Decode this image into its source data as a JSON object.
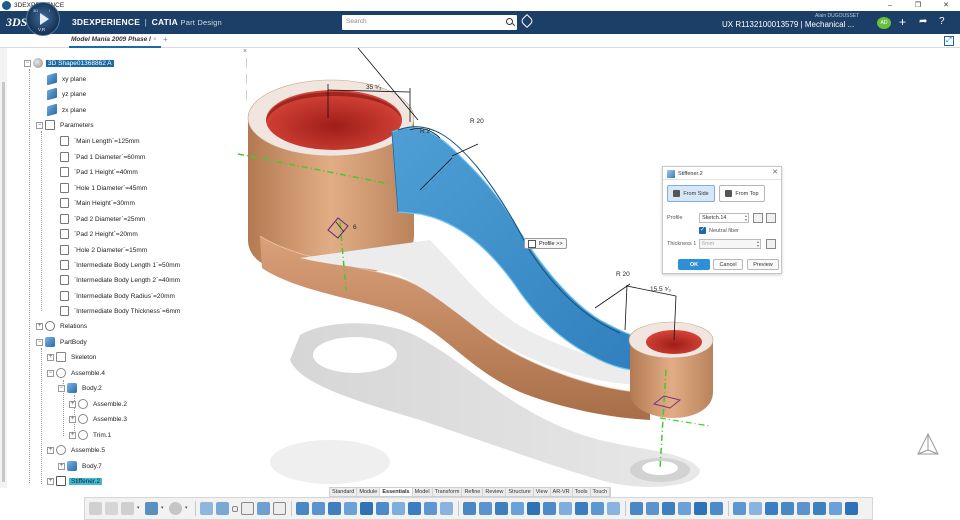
{
  "os": {
    "title": "3DEXPERIENCE",
    "minimize": "–",
    "maximize": "❐",
    "close": "✕"
  },
  "header": {
    "logo": "3DS",
    "brand": "3DEXPERIENCE",
    "brand_sep": "|",
    "product": "CATIA",
    "app": "Part Design",
    "compass_label": "V,R",
    "search_placeholder": "Search",
    "user": "Alain DUGOUSSET",
    "context": "UX R1132100013579 | Mechanical ...",
    "avatar": "AD"
  },
  "tabs": [
    {
      "label": "Model Mania 2009 Phase I",
      "close": "×"
    }
  ],
  "tree": {
    "root": "3D Shape01368862 A",
    "planes": [
      "xy plane",
      "yz plane",
      "zx plane"
    ],
    "parameters_label": "Parameters",
    "parameters": [
      "`Main Length`=125mm",
      "`Pad 1 Diameter`=60mm",
      "`Pad 1 Height`=40mm",
      "`Hole 1 Diameter`=45mm",
      "`Main Height`=30mm",
      "`Pad 2 Diameter`=25mm",
      "`Pad 2 Height`=20mm",
      "`Hole 2 Diameter`=15mm",
      "`Intermediate Body Length 1`=50mm",
      "`Intermediate Body Length 2`=40mm",
      "`Intermediate Body Radius`=20mm",
      "`Intermediate Body Thickness`=6mm"
    ],
    "relations": "Relations",
    "partbody": "PartBody",
    "skeleton": "Skeleton",
    "assemble4": "Assemble.4",
    "body2": "Body.2",
    "assemble2": "Assemble.2",
    "assemble3": "Assemble.3",
    "trim1": "Trim.1",
    "assemble5": "Assemble.5",
    "body7": "Body.7",
    "stiffener": "Stiffener.2"
  },
  "viewport": {
    "dims": {
      "d35": "35 ⁵⁄₃",
      "r20a": "R 20",
      "r20b": "R 20",
      "d155": "15.5 ⁵⁄₃",
      "r2": "R 2",
      "d6": "6"
    },
    "profile_tip": "Profile >>",
    "colors": {
      "blue_face": "#3f93cf",
      "copper": "#c98c5f",
      "hole_red": "#c4332c",
      "green_axis": "#46c92d"
    }
  },
  "dialog": {
    "title": "Stiffener.2",
    "close": "✕",
    "from_side": "From Side",
    "from_top": "From Top",
    "profile_label": "Profile",
    "profile_value": "Sketch.14",
    "neutral_fiber": "Neutral fiber",
    "thickness_label": "Thickness 1",
    "thickness_value": "6mm",
    "ok": "OK",
    "cancel": "Cancel",
    "preview": "Preview"
  },
  "section_tabs": [
    "Standard",
    "Module",
    "Essentials",
    "Model",
    "Transform",
    "Refine",
    "Review",
    "Structure",
    "View",
    "AR-VR",
    "Tools",
    "Touch"
  ],
  "active_section": "Essentials"
}
